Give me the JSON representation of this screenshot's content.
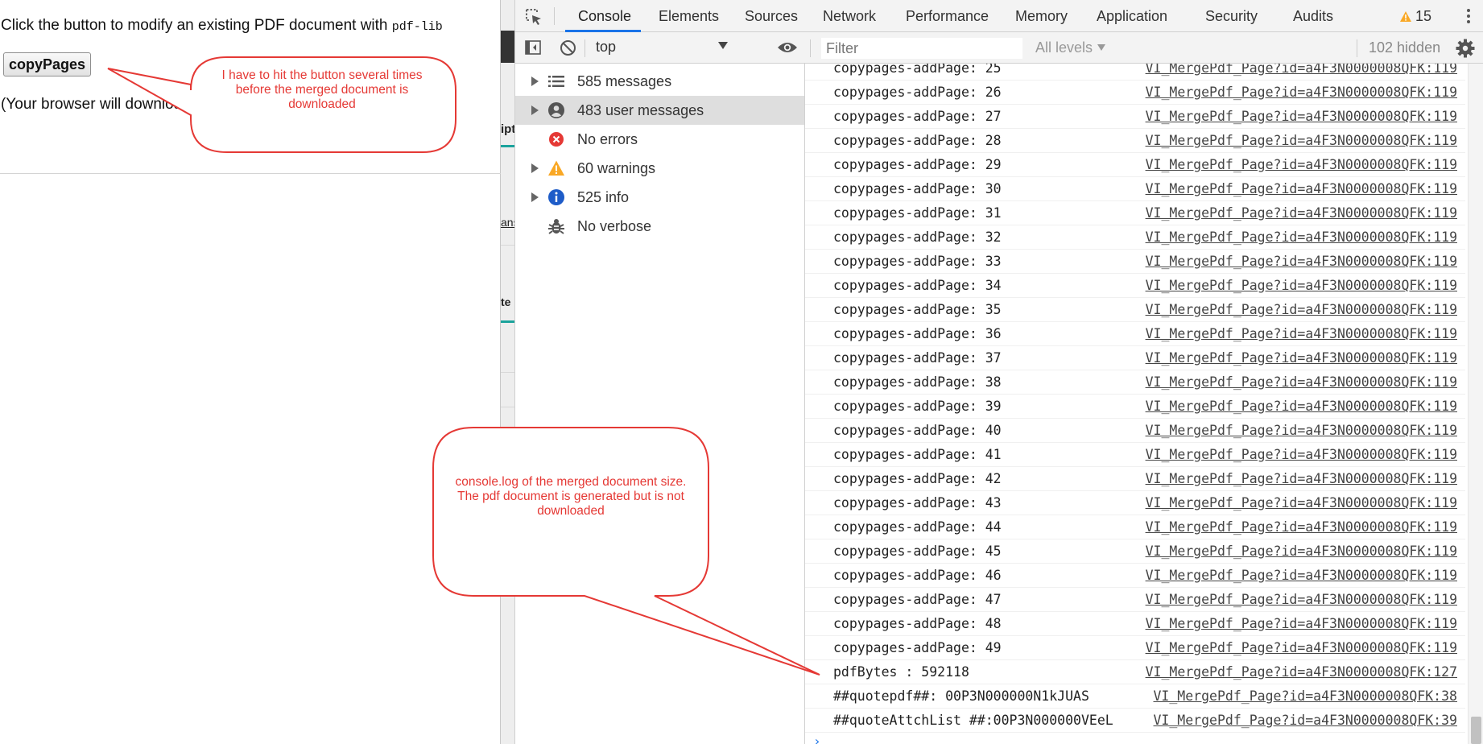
{
  "page": {
    "intro_text": "Click the button to modify an existing PDF document with ",
    "intro_code": "pdf-lib",
    "button_label": "copyPages",
    "download_note": "(Your browser will downloa"
  },
  "peek": {
    "text1": "ipt",
    "text2": "ans",
    "text3": "te"
  },
  "devtools": {
    "tabs": [
      "Console",
      "Elements",
      "Sources",
      "Network",
      "Performance",
      "Memory",
      "Application",
      "Security",
      "Audits"
    ],
    "active_tab": "Console",
    "warning_count": "15",
    "toolbar": {
      "context": "top",
      "filter_placeholder": "Filter",
      "levels": "All levels",
      "hidden": "102 hidden"
    },
    "sidebar": [
      {
        "label": "585 messages",
        "icon": "list-icon",
        "expandable": true
      },
      {
        "label": "483 user messages",
        "icon": "user-icon",
        "expandable": true
      },
      {
        "label": "No errors",
        "icon": "error-icon",
        "expandable": false
      },
      {
        "label": "60 warnings",
        "icon": "warning-icon",
        "expandable": true
      },
      {
        "label": "525 info",
        "icon": "info-icon",
        "expandable": true
      },
      {
        "label": "No verbose",
        "icon": "bug-icon",
        "expandable": false
      }
    ],
    "console_rows": [
      {
        "msg": "copypages-addPage: 25",
        "src": "VI_MergePdf_Page?id=a4F3N0000008QFK:119"
      },
      {
        "msg": "copypages-addPage: 26",
        "src": "VI_MergePdf_Page?id=a4F3N0000008QFK:119"
      },
      {
        "msg": "copypages-addPage: 27",
        "src": "VI_MergePdf_Page?id=a4F3N0000008QFK:119"
      },
      {
        "msg": "copypages-addPage: 28",
        "src": "VI_MergePdf_Page?id=a4F3N0000008QFK:119"
      },
      {
        "msg": "copypages-addPage: 29",
        "src": "VI_MergePdf_Page?id=a4F3N0000008QFK:119"
      },
      {
        "msg": "copypages-addPage: 30",
        "src": "VI_MergePdf_Page?id=a4F3N0000008QFK:119"
      },
      {
        "msg": "copypages-addPage: 31",
        "src": "VI_MergePdf_Page?id=a4F3N0000008QFK:119"
      },
      {
        "msg": "copypages-addPage: 32",
        "src": "VI_MergePdf_Page?id=a4F3N0000008QFK:119"
      },
      {
        "msg": "copypages-addPage: 33",
        "src": "VI_MergePdf_Page?id=a4F3N0000008QFK:119"
      },
      {
        "msg": "copypages-addPage: 34",
        "src": "VI_MergePdf_Page?id=a4F3N0000008QFK:119"
      },
      {
        "msg": "copypages-addPage: 35",
        "src": "VI_MergePdf_Page?id=a4F3N0000008QFK:119"
      },
      {
        "msg": "copypages-addPage: 36",
        "src": "VI_MergePdf_Page?id=a4F3N0000008QFK:119"
      },
      {
        "msg": "copypages-addPage: 37",
        "src": "VI_MergePdf_Page?id=a4F3N0000008QFK:119"
      },
      {
        "msg": "copypages-addPage: 38",
        "src": "VI_MergePdf_Page?id=a4F3N0000008QFK:119"
      },
      {
        "msg": "copypages-addPage: 39",
        "src": "VI_MergePdf_Page?id=a4F3N0000008QFK:119"
      },
      {
        "msg": "copypages-addPage: 40",
        "src": "VI_MergePdf_Page?id=a4F3N0000008QFK:119"
      },
      {
        "msg": "copypages-addPage: 41",
        "src": "VI_MergePdf_Page?id=a4F3N0000008QFK:119"
      },
      {
        "msg": "copypages-addPage: 42",
        "src": "VI_MergePdf_Page?id=a4F3N0000008QFK:119"
      },
      {
        "msg": "copypages-addPage: 43",
        "src": "VI_MergePdf_Page?id=a4F3N0000008QFK:119"
      },
      {
        "msg": "copypages-addPage: 44",
        "src": "VI_MergePdf_Page?id=a4F3N0000008QFK:119"
      },
      {
        "msg": "copypages-addPage: 45",
        "src": "VI_MergePdf_Page?id=a4F3N0000008QFK:119"
      },
      {
        "msg": "copypages-addPage: 46",
        "src": "VI_MergePdf_Page?id=a4F3N0000008QFK:119"
      },
      {
        "msg": "copypages-addPage: 47",
        "src": "VI_MergePdf_Page?id=a4F3N0000008QFK:119"
      },
      {
        "msg": "copypages-addPage: 48",
        "src": "VI_MergePdf_Page?id=a4F3N0000008QFK:119"
      },
      {
        "msg": "copypages-addPage: 49",
        "src": "VI_MergePdf_Page?id=a4F3N0000008QFK:119"
      },
      {
        "msg": "pdfBytes : 592118",
        "src": "VI_MergePdf_Page?id=a4F3N0000008QFK:127"
      },
      {
        "msg": "##quotepdf##: 00P3N000000N1kJUAS",
        "src": "VI_MergePdf_Page?id=a4F3N0000008QFK:38"
      },
      {
        "msg": "##quoteAttchList ##:00P3N000000VEeL",
        "src": "VI_MergePdf_Page?id=a4F3N0000008QFK:39"
      }
    ]
  },
  "annotations": {
    "callout1": "I have to hit the button several times before the merged document is downloaded",
    "callout2": "console.log of  the merged document size. The pdf document is generated but is not downloaded"
  },
  "colors": {
    "callout_stroke": "#e53935",
    "accent": "#1a73e8",
    "warning": "#f9a825",
    "error": "#e53935",
    "info": "#1e5cc8"
  }
}
